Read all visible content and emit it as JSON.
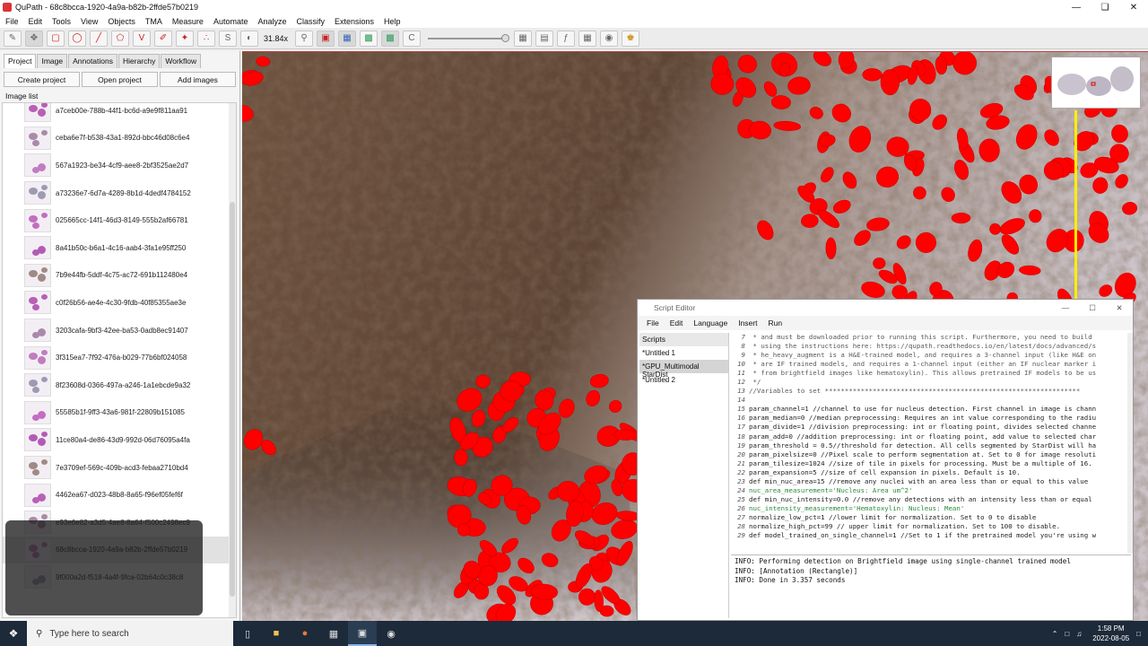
{
  "window": {
    "title": "QuPath - 68c8bcca-1920-4a9a-b82b-2ffde57b0219"
  },
  "menu": [
    "File",
    "Edit",
    "Tools",
    "View",
    "Objects",
    "TMA",
    "Measure",
    "Automate",
    "Analyze",
    "Classify",
    "Extensions",
    "Help"
  ],
  "toolbar": {
    "zoom": "31.84x"
  },
  "left_panel": {
    "tabs": [
      "Project",
      "Image",
      "Annotations",
      "Hierarchy",
      "Workflow"
    ],
    "buttons": [
      "Create project",
      "Open project",
      "Add images"
    ],
    "list_label": "Image list",
    "images": [
      "a7ceb00e-788b-44f1-bc6d-a9e9f811aa91",
      "ceba6e7f-b538-43a1-892d-bbc46d08c6e4",
      "567a1923-be34-4cf9-aee8-2bf3525ae2d7",
      "a73236e7-6d7a-4289-8b1d-4dedf4784152",
      "025665cc-14f1-46d3-8149-555b2af66781",
      "8a41b50c-b6a1-4c16-aab4-3fa1e95ff250",
      "7b9e44fb-5ddf-4c75-ac72-691b112480e4",
      "c0f26b56-ae4e-4c30-9fdb-40f85355ae3e",
      "3203cafa-9bf3-42ee-ba53-0adb8ec91407",
      "3f315ea7-7f92-476a-b029-77b6bf024058",
      "8f23608d-0366-497a-a246-1a1ebcde9a32",
      "55585b1f-9ff3-43a6-981f-22809b151085",
      "11ce80a4-de86-43d9-992d-06d76095a4fa",
      "7e3709ef-569c-409b-acd3-febaa2710bd4",
      "4462ea67-d023-48b8-8a65-f96ef05fef6f",
      "e93e6e82-a3d5-4ae8-8a64-f500c2498ec9",
      "68c8bcca-1920-4a9a-b82b-2ffde57b0219",
      "9f000a2d-f518-4a4f-9fca-02b64c0c38c8"
    ],
    "selected_index": 16
  },
  "script_editor": {
    "title": "Script Editor",
    "menu": [
      "File",
      "Edit",
      "Language",
      "Insert",
      "Run"
    ],
    "scripts_header": "Scripts",
    "scripts": [
      "*Untitled 1",
      "*GPU_Multimodal StarDist",
      "*Untitled 2"
    ],
    "selected_script": 1,
    "code": [
      {
        "n": "7",
        "t": " * and must be downloaded prior to running this script. Furthermore, you need to build",
        "c": "c"
      },
      {
        "n": "8",
        "t": " * using the instructions here: https://qupath.readthedocs.io/en/latest/docs/advanced/s",
        "c": "c"
      },
      {
        "n": "9",
        "t": " * he_heavy_augment is a H&E-trained model, and requires a 3-channel input (like H&E on",
        "c": "c"
      },
      {
        "n": "10",
        "t": " * are IF trained models, and requires a 1-channel input (either an IF nuclear marker i",
        "c": "c"
      },
      {
        "n": "11",
        "t": " * from brightfield images like hematoxylin). This allows pretrained IF models to be us",
        "c": "c"
      },
      {
        "n": "12",
        "t": " */",
        "c": "c"
      },
      {
        "n": "13",
        "t": "//Variables to set ****************************************************************",
        "c": "c"
      },
      {
        "n": "14",
        "t": "",
        "c": "k"
      },
      {
        "n": "15",
        "t": "param_channel=1 //channel to use for nucleus detection. First channel in image is chann",
        "c": "k"
      },
      {
        "n": "16",
        "t": "param_median=0 //median preprocessing: Requires an int value corresponding to the radiu",
        "c": "k"
      },
      {
        "n": "17",
        "t": "param_divide=1 //division preprocessing: int or floating point, divides selected channe",
        "c": "k"
      },
      {
        "n": "18",
        "t": "param_add=0 //addition preprocessing: int or floating point, add value to selected char",
        "c": "k"
      },
      {
        "n": "19",
        "t": "param_threshold = 0.5//threshold for detection. All cells segmented by StarDist will ha",
        "c": "k"
      },
      {
        "n": "20",
        "t": "param_pixelsize=0 //Pixel scale to perform segmentation at. Set to 0 for image resoluti",
        "c": "k"
      },
      {
        "n": "21",
        "t": "param_tilesize=1024 //size of tile in pixels for processing. Must be a multiple of 16.",
        "c": "k"
      },
      {
        "n": "22",
        "t": "param_expansion=5 //size of cell expansion in pixels. Default is 10.",
        "c": "k"
      },
      {
        "n": "23",
        "t": "def min_nuc_area=15 //remove any nuclei with an area less than or equal to this value",
        "c": "k"
      },
      {
        "n": "24",
        "t": "nuc_area_measurement='Nucleus: Area um^2'",
        "c": "s"
      },
      {
        "n": "25",
        "t": "def min_nuc_intensity=0.0 //remove any detections with an intensity less than or equal",
        "c": "k"
      },
      {
        "n": "26",
        "t": "nuc_intensity_measurement='Hematoxylin: Nucleus: Mean'",
        "c": "s"
      },
      {
        "n": "27",
        "t": "normalize_low_pct=1 //lower limit for normalization. Set to 0 to disable",
        "c": "k"
      },
      {
        "n": "28",
        "t": "normalize_high_pct=99 // upper limit for normalization. Set to 100 to disable.",
        "c": "k"
      },
      {
        "n": "29",
        "t": "def model_trained_on_single_channel=1 //Set to 1 if the pretrained model you're using w",
        "c": "k"
      }
    ],
    "log": [
      "INFO: Performing detection on Brightfield image using single-channel trained model",
      "INFO: [Annotation (Rectangle)]",
      "INFO: Done in 3.357 seconds"
    ]
  },
  "taskbar": {
    "search_placeholder": "Type here to search",
    "time": "1:58 PM",
    "date": "2022-08-05"
  },
  "colors": {
    "detection": "#ff0000",
    "overlay_line": "#ffee00",
    "stain_brown": "#6b4a34",
    "stain_light": "#cfc6cc"
  }
}
